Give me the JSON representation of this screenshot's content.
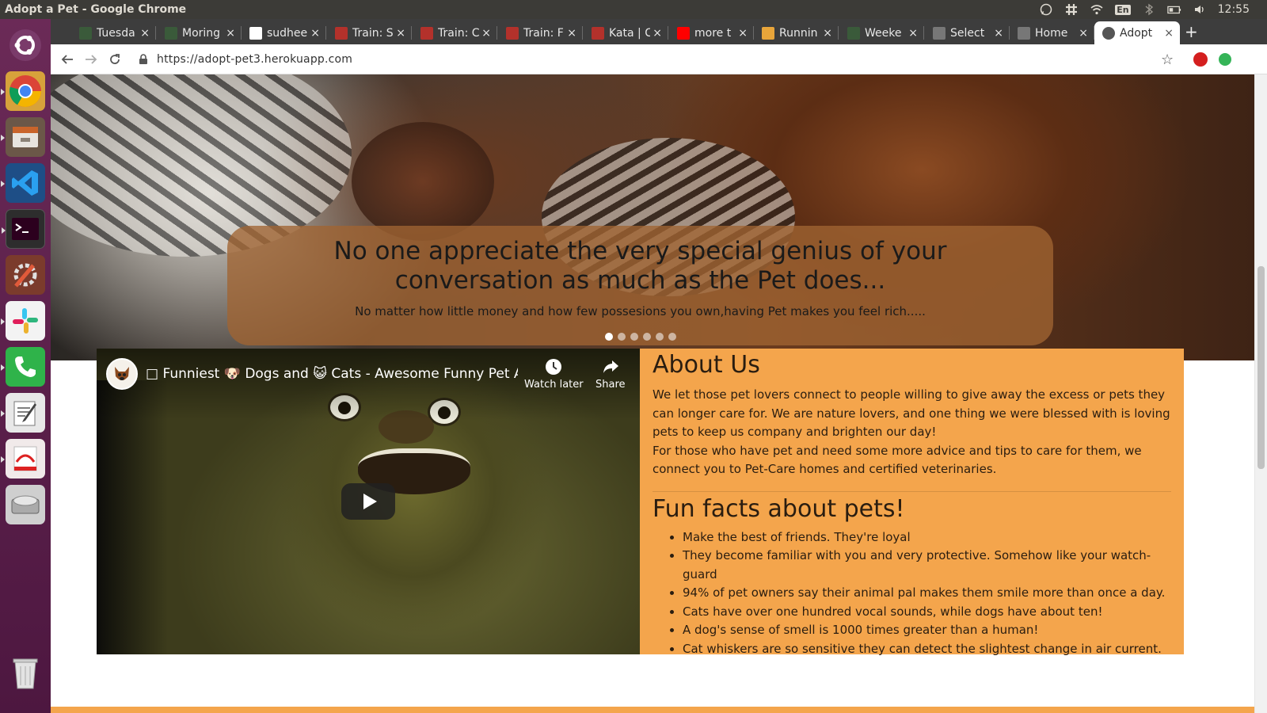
{
  "os": {
    "window_title": "Adopt a Pet - Google Chrome",
    "keyboard_layout": "En",
    "clock": "12:55"
  },
  "launcher": {
    "apps": [
      {
        "name": "ubuntu-dash",
        "color": "#5e2750"
      },
      {
        "name": "google-chrome",
        "color": "#ffffff"
      },
      {
        "name": "files",
        "color": "#8a7762"
      },
      {
        "name": "vs-code",
        "color": "#2f7dc7"
      },
      {
        "name": "terminal",
        "color": "#2d2d2d"
      },
      {
        "name": "system-settings",
        "color": "#c84b31"
      },
      {
        "name": "slack",
        "color": "#ffffff"
      },
      {
        "name": "phone",
        "color": "#2fb34a"
      },
      {
        "name": "text-editor",
        "color": "#e8e8e8"
      },
      {
        "name": "document-viewer",
        "color": "#e6e6e6"
      },
      {
        "name": "disks",
        "color": "#b9b9b9"
      },
      {
        "name": "trash",
        "color": "#d8d8d8"
      }
    ]
  },
  "browser": {
    "tabs": [
      {
        "label": "Tuesda",
        "favicon_color": "#3a5a3a"
      },
      {
        "label": "Moring",
        "favicon_color": "#3a5a3a"
      },
      {
        "label": "sudhee",
        "favicon_color": "#ffffff"
      },
      {
        "label": "Train: S",
        "favicon_color": "#b3312b"
      },
      {
        "label": "Train: C",
        "favicon_color": "#b3312b"
      },
      {
        "label": "Train: F",
        "favicon_color": "#b3312b"
      },
      {
        "label": "Kata | C",
        "favicon_color": "#b3312b"
      },
      {
        "label": "more t",
        "favicon_color": "#ff0000"
      },
      {
        "label": "Runnin",
        "favicon_color": "#e8a53a"
      },
      {
        "label": "Weeke",
        "favicon_color": "#3a5a3a"
      },
      {
        "label": "Select",
        "favicon_color": "#777777"
      },
      {
        "label": "Home",
        "favicon_color": "#777777"
      },
      {
        "label": "Adopt",
        "favicon_color": "#555555",
        "active": true
      }
    ],
    "close_glyph": "×",
    "new_tab_glyph": "+",
    "url": "https://adopt-pet3.herokuapp.com"
  },
  "page": {
    "carousel": {
      "title": "No one appreciate the very special genius of your conversation as much as the Pet does...",
      "subtitle": "No matter how little money and how few possesions you own,having Pet makes you feel rich.....",
      "slide_count": 6,
      "active_slide": 0
    },
    "video": {
      "title": "□ Funniest 🐶 Dogs and 😺 Cats - Awesome Funny Pet Ani...",
      "watch_later_label": "Watch later",
      "share_label": "Share"
    },
    "about": {
      "heading": "About Us",
      "paragraph_1": "We let those pet lovers connect to people willing to give away the excess or pets they can longer care for. We are nature lovers, and one thing we were blessed with is loving pets to keep us company and brighten our day!",
      "paragraph_2": "For those who have pet and need some more advice and tips to care for them, we connect you to Pet-Care homes and certified veterinaries."
    },
    "fun_facts": {
      "heading": "Fun facts about pets!",
      "items": [
        "Make the best of friends. They're loyal",
        "They become familiar with you and very protective. Somehow like your watch-guard",
        "94% of pet owners say their animal pal makes them smile more than once a day.",
        "Cats have over one hundred vocal sounds, while dogs have about ten!",
        "A dog's sense of smell is 1000 times greater than a human!",
        "Cat whiskers are so sensitive they can detect the slightest change in air current."
      ]
    },
    "accent_color": "#f4a54c"
  }
}
